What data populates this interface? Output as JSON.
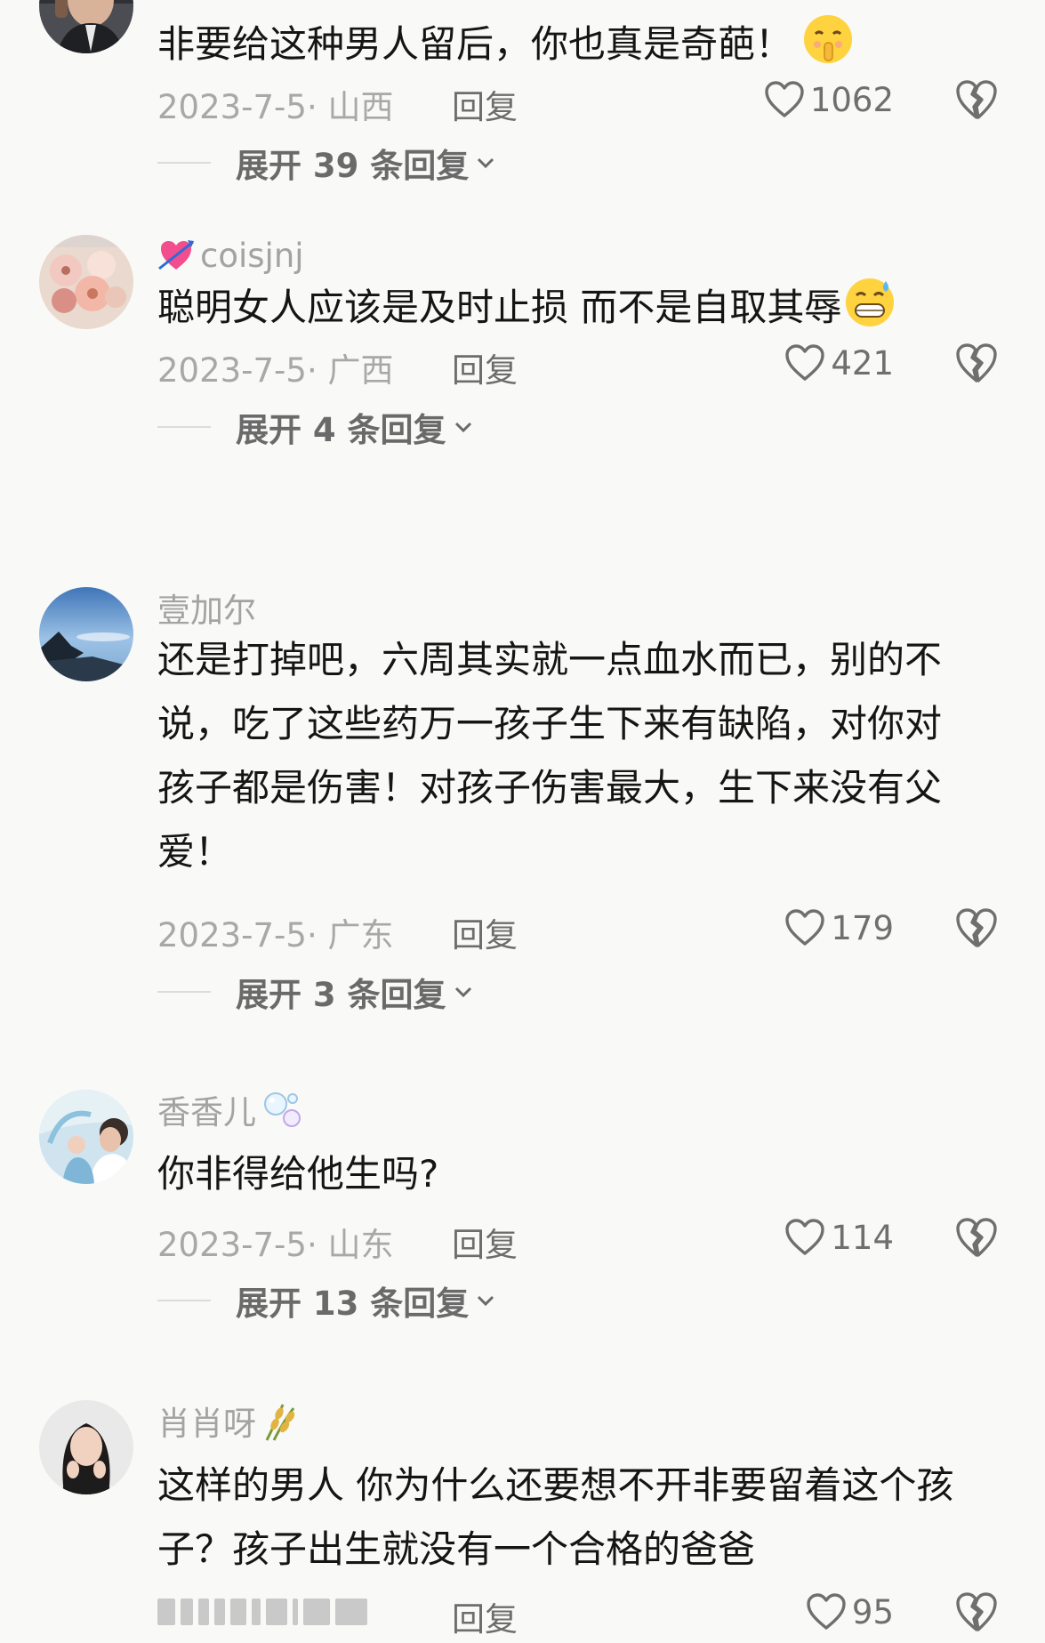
{
  "comments": [
    {
      "username": "",
      "text": "非要给这种男人留后，你也真是奇葩！",
      "emoji": "shushing-face-emoji",
      "date": "2023-7-5",
      "location": "山西",
      "reply_label": "回复",
      "likes": "1062",
      "expand": "展开 39 条回复"
    },
    {
      "username": "coisjnj",
      "username_icon": "heart-with-arrow-icon",
      "text": "聪明女人应该是及时止损 而不是自取其辱",
      "emoji": "grinning-sweat-face-emoji",
      "date": "2023-7-5",
      "location": "广西",
      "reply_label": "回复",
      "likes": "421",
      "expand": "展开 4 条回复"
    },
    {
      "username": "壹加尔",
      "text": "还是打掉吧，六周其实就一点血水而已，别的不说，吃了这些药万一孩子生下来有缺陷，对你对孩子都是伤害！对孩子伤害最大，生下来没有父爱！",
      "date": "2023-7-5",
      "location": "广东",
      "reply_label": "回复",
      "likes": "179",
      "expand": "展开 3 条回复"
    },
    {
      "username": "香香儿",
      "username_icon": "bubbles-icon",
      "text": "你非得给他生吗?",
      "date": "2023-7-5",
      "location": "山东",
      "reply_label": "回复",
      "likes": "114",
      "expand": "展开 13 条回复"
    },
    {
      "username": "肖肖呀",
      "username_icon": "rice-ear-icon",
      "text": "这样的男人 你为什么还要想不开非要留着这个孩子？孩子出生就没有一个合格的爸爸",
      "reply_label": "回复",
      "likes": "95"
    }
  ],
  "colors": {
    "background": "#f9f9f7",
    "text": "#151515",
    "muted": "#a8a8a8",
    "icon": "#6f6f6f"
  }
}
